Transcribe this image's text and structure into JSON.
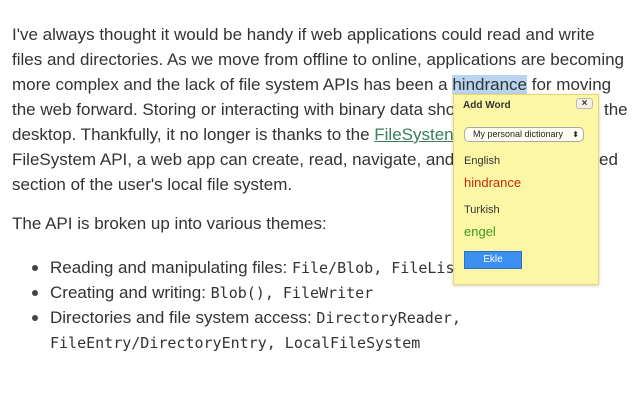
{
  "paragraph1": {
    "l1": "I've always thought it would be handy if web applications could read and write",
    "l2": "files and directories. As we move from offline to online, applications are becoming",
    "l3a": "more complex and the lack of file system APIs has been a ",
    "l3hl": "hindrance",
    "l3b": " for moving",
    "l4a": "the web forward. Storing or interacting with binary data sho",
    "l4b": "the",
    "l5a": "desktop. Thankfully, it no longer is thanks to the ",
    "l5link": "FileSysten",
    "l6a": "FileSystem API, a web app can create, read, navigate, and",
    "l6b": "ed",
    "l7": "section of the user's local file system."
  },
  "paragraph2": "The API is broken up into various themes:",
  "list": [
    {
      "text": "Reading and manipulating files: ",
      "code": "File/Blob, FileLis"
    },
    {
      "text": "Creating and writing: ",
      "code": "Blob(), FileWriter"
    },
    {
      "text": "Directories and file system access: ",
      "code": "DirectoryReader,",
      "code2": "FileEntry/DirectoryEntry, LocalFileSystem"
    }
  ],
  "popup": {
    "title": "Add Word",
    "close": "×",
    "dictionary": "My personal dictionary",
    "source_lang": "English",
    "source_word": "hindrance",
    "target_lang": "Turkish",
    "target_word": "engel",
    "button": "Ekle",
    "colors": {
      "source_word": "#c62a10",
      "target_word": "#3c9a1c",
      "button": "#3a8ff0"
    }
  }
}
